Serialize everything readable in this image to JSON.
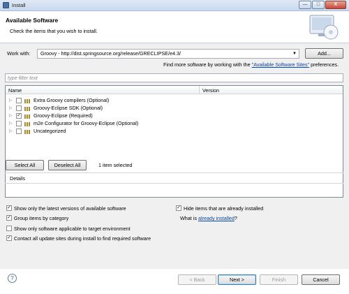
{
  "window": {
    "title": "Install",
    "min_symbol": "—",
    "max_symbol": "□",
    "close_symbol": "X"
  },
  "header": {
    "title": "Available Software",
    "subtitle": "Check the items that you wish to install."
  },
  "work_with": {
    "label": "Work with:",
    "value": "Groovy - http://dist.springsource.org/release/GRECLIPSE/e4.3/",
    "add_label": "Add...",
    "find_more_prefix": "Find more software by working with the",
    "find_more_link": "\"Available Software Sites\"",
    "find_more_suffix": "preferences."
  },
  "filter": {
    "placeholder": "type filter text"
  },
  "table": {
    "columns": [
      "Name",
      "Version"
    ],
    "rows": [
      {
        "label": "Extra Groovy compilers (Optional)",
        "checked": false
      },
      {
        "label": "Groovy-Eclipse SDK (Optional)",
        "checked": false
      },
      {
        "label": "Groovy-Eclipse (Required)",
        "checked": true
      },
      {
        "label": "m2e Configurator for Groovy-Eclipse (Optional)",
        "checked": false
      },
      {
        "label": "Uncategorized",
        "checked": false
      }
    ]
  },
  "selection": {
    "select_all": "Select All",
    "deselect_all": "Deselect All",
    "status": "1 item selected"
  },
  "details": {
    "label": "Details"
  },
  "options": {
    "latest_versions": {
      "label": "Show only the latest versions of available software",
      "checked": true
    },
    "group_by_category": {
      "label": "Group items by category",
      "checked": true
    },
    "target_env": {
      "label": "Show only software applicable to target environment",
      "checked": false
    },
    "contact_sites": {
      "label": "Contact all update sites during install to find required software",
      "checked": true
    },
    "hide_installed": {
      "label": "Hide items that are already installed",
      "checked": true
    },
    "what_is_prefix": "What is",
    "what_is_link": "already installed",
    "what_is_suffix": "?"
  },
  "footer": {
    "help_symbol": "?",
    "back": "< Back",
    "next": "Next >",
    "finish": "Finish",
    "cancel": "Cancel"
  },
  "colors": {
    "link": "#0645ad",
    "panel": "#f0f0f0",
    "accent": "#3c7fb1"
  }
}
